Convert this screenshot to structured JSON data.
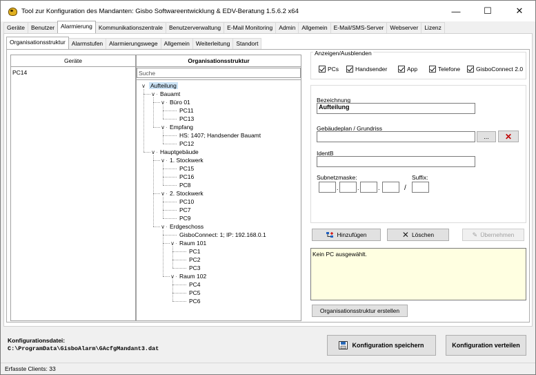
{
  "window": {
    "title": "Tool zur Konfiguration des Mandanten: Gisbo Softwareentwicklung & EDV-Beratung 1.5.6.2 x64",
    "controls": {
      "minimize": "—",
      "maximize": "☐",
      "close": "✕"
    }
  },
  "main_tabs": [
    "Geräte",
    "Benutzer",
    "Alarmierung",
    "Kommunikationszentrale",
    "Benutzerverwaltung",
    "E-Mail Monitoring",
    "Admin",
    "Allgemein",
    "E-Mail/SMS-Server",
    "Webserver",
    "Lizenz"
  ],
  "main_tab_active": "Alarmierung",
  "sub_tabs": [
    "Organisationsstruktur",
    "Alarmstufen",
    "Alarmierungswege",
    "Allgemein",
    "Weiterleitung",
    "Standort"
  ],
  "sub_tab_active": "Organisationsstruktur",
  "devices": {
    "header": "Geräte",
    "items": [
      "PC14"
    ]
  },
  "org": {
    "header": "Organisationsstruktur",
    "search_placeholder": "Suche",
    "tree": [
      "Aufteilung",
      "Bauamt",
      "Büro 01",
      "PC11",
      "PC13",
      "Empfang",
      "HS: 1407; Handsender Bauamt",
      "PC12",
      "Hauptgebäude",
      "1. Stockwerk",
      "PC15",
      "PC16",
      "PC8",
      "2. Stockwerk",
      "PC10",
      "PC7",
      "PC9",
      "Erdgeschoss",
      "GisboConnect: 1; IP: 192.168.0.1",
      "Raum 101",
      "PC1",
      "PC2",
      "PC3",
      "Raum 102",
      "PC4",
      "PC5",
      "PC6"
    ]
  },
  "display_group": {
    "title": "Anzeigen/Ausblenden",
    "options": [
      {
        "label": "PCs",
        "checked": true
      },
      {
        "label": "Handsender",
        "checked": true
      },
      {
        "label": "App",
        "checked": true
      },
      {
        "label": "Telefone",
        "checked": true
      },
      {
        "label": "GisboConnect 2.0",
        "checked": true
      }
    ]
  },
  "details": {
    "bezeichnung_label": "Bezeichnung",
    "bezeichnung_value": "Aufteilung",
    "gebaeudeplan_label": "Gebäudeplan / Grundriss",
    "gebaeudeplan_value": "",
    "browse_label": "...",
    "clear_label": "✕",
    "identb_label": "IdentB",
    "identb_value": "",
    "subnet_label": "Subnetzmaske:",
    "suffix_label": "Suffix:",
    "slash": "/"
  },
  "actions": {
    "add": "Hinzufügen",
    "delete": "Löschen",
    "apply": "Übernehmen"
  },
  "status_message": "Kein PC ausgewählt.",
  "create_structure_label": "Organisationsstruktur erstellen",
  "config": {
    "label": "Konfigurationsdatei:",
    "path": "C:\\ProgramData\\GisboAlarm\\GAcfgMandant3.dat",
    "save_label": "Konfiguration speichern",
    "distribute_label": "Konfiguration verteilen"
  },
  "statusbar": {
    "clients": "Erfasste Clients: 33"
  }
}
